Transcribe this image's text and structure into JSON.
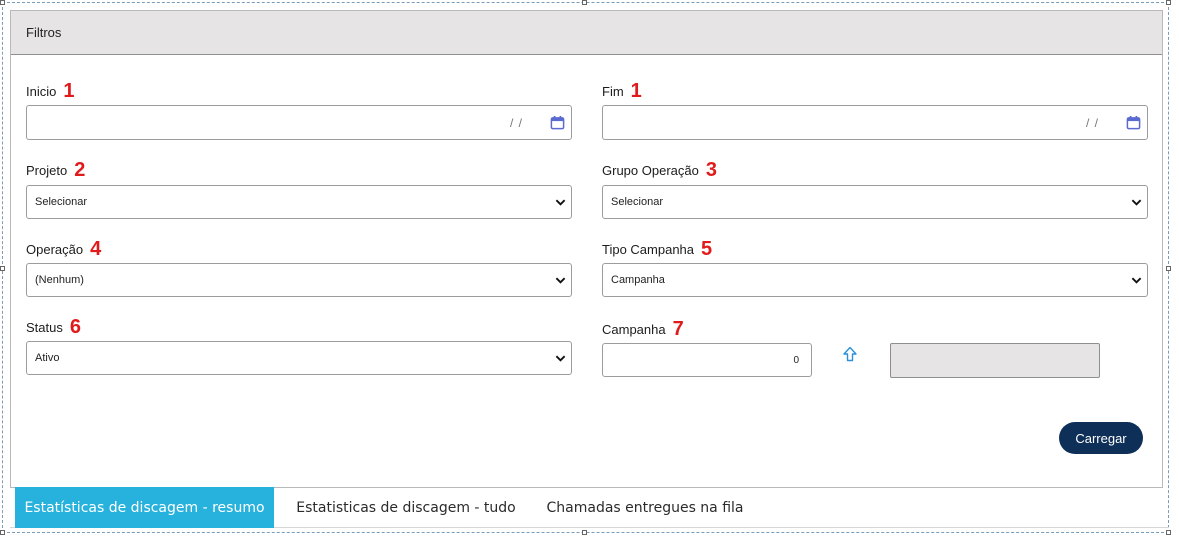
{
  "panel": {
    "title": "Filtros"
  },
  "fields": {
    "inicio": {
      "label": "Inicio",
      "badge": "1",
      "placeholder": "/ /",
      "icon": "calendar-icon"
    },
    "fim": {
      "label": "Fim",
      "badge": "1",
      "placeholder": "/ /",
      "icon": "calendar-icon"
    },
    "projeto": {
      "label": "Projeto",
      "badge": "2",
      "value": "Selecionar"
    },
    "grupo_operacao": {
      "label": "Grupo Operação",
      "badge": "3",
      "value": "Selecionar"
    },
    "operacao": {
      "label": "Operação",
      "badge": "4",
      "value": "(Nenhum)"
    },
    "tipo_campanha": {
      "label": "Tipo Campanha",
      "badge": "5",
      "value": "Campanha"
    },
    "status": {
      "label": "Status",
      "badge": "6",
      "value": "Ativo"
    },
    "campanha": {
      "label": "Campanha",
      "badge": "7",
      "value": "0",
      "icon": "arrow-up-icon"
    }
  },
  "buttons": {
    "load": "Carregar"
  },
  "tabs": [
    {
      "label": "Estatísticas de discagem - resumo",
      "active": true
    },
    {
      "label": "Estatisticas de discagem - tudo",
      "active": false
    },
    {
      "label": "Chamadas entregues na fila",
      "active": false
    }
  ],
  "colors": {
    "accent_tab": "#26b2dc",
    "button": "#0e2f57",
    "badge": "#e11b1b",
    "calendar_icon": "#5b6ad0",
    "upload_icon": "#2d8fd8",
    "header_bg": "#e7e4e6"
  }
}
